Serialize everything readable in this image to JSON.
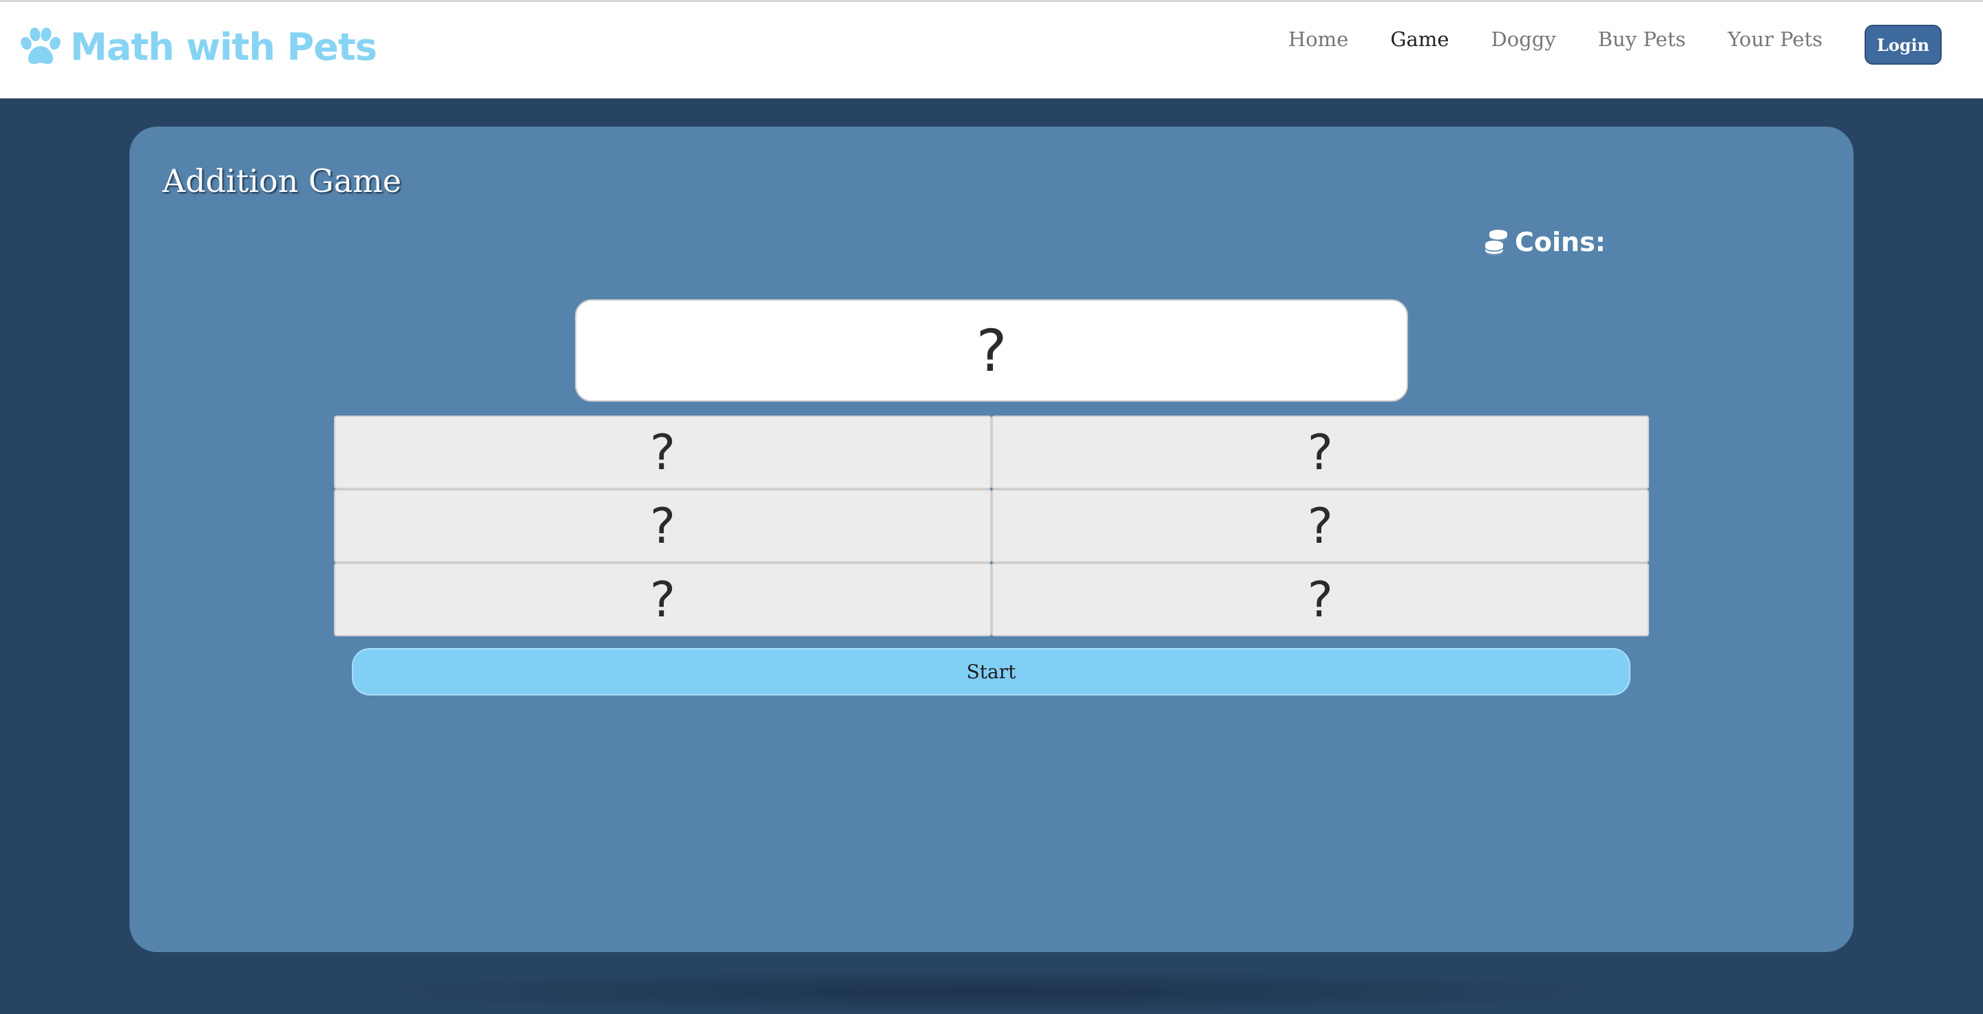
{
  "header": {
    "brand": {
      "icon": "paw-icon",
      "name": "Math with Pets",
      "color": "#87d3f4"
    },
    "nav": [
      {
        "label": "Home",
        "active": false
      },
      {
        "label": "Game",
        "active": true
      },
      {
        "label": "Doggy",
        "active": false
      },
      {
        "label": "Buy Pets",
        "active": false
      },
      {
        "label": "Your Pets",
        "active": false
      }
    ],
    "login_label": "Login"
  },
  "game": {
    "title": "Addition Game",
    "coins": {
      "icon": "coins-icon",
      "label": "Coins:"
    },
    "question": "?",
    "answers": [
      "?",
      "?",
      "?",
      "?",
      "?",
      "?"
    ],
    "start_label": "Start"
  },
  "colors": {
    "page_background": "#274463",
    "panel_background": "#5583ab",
    "start_button": "#82cff6",
    "login_button": "#3e6a9d"
  }
}
